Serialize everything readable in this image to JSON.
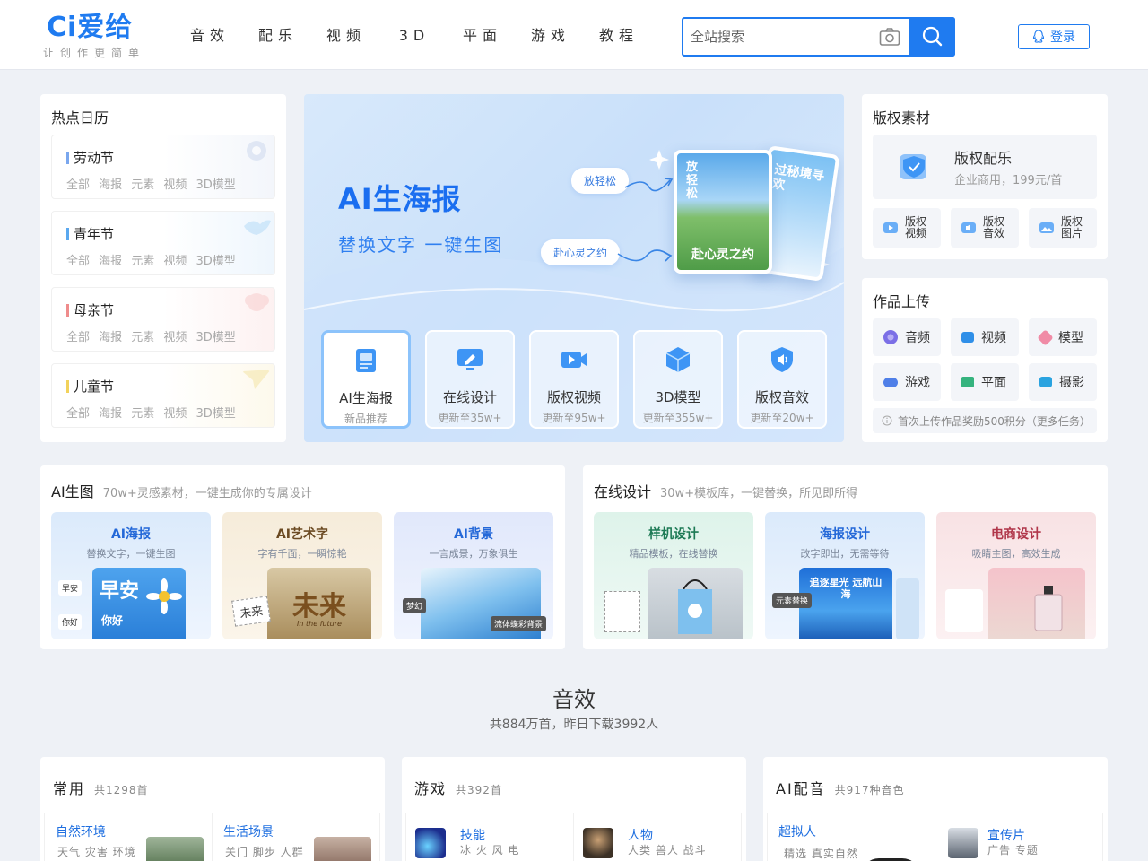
{
  "header": {
    "logo_mark": "Ci爱给",
    "logo_sub": "让创作更简单",
    "nav": [
      "音效",
      "配乐",
      "视频",
      "3D",
      "平面",
      "游戏",
      "教程"
    ],
    "search_placeholder": "全站搜索",
    "login": "登录"
  },
  "calendar": {
    "title": "热点日历",
    "items": [
      {
        "name": "劳动节",
        "tags": "全部 海报 元素 视频 3D模型",
        "color": "#7aa7ee"
      },
      {
        "name": "青年节",
        "tags": "全部 海报 元素 视频 3D模型",
        "color": "#5aa8ef"
      },
      {
        "name": "母亲节",
        "tags": "全部 海报 元素 视频 3D模型",
        "color": "#ef8c8c"
      },
      {
        "name": "儿童节",
        "tags": "全部 海报 元素 视频 3D模型",
        "color": "#f2d25b"
      }
    ]
  },
  "banner": {
    "title": "AI生海报",
    "subtitle": "替换文字 一键生图",
    "pill_1": "放轻松",
    "pill_2": "赴心灵之约",
    "poster_text_1": "放轻松",
    "poster_text_2": "赴心灵之约",
    "poster_text_3": "过秘境寻欢",
    "features": [
      {
        "title": "AI生海报",
        "sub": "新品推荐",
        "color": "#3e95f5"
      },
      {
        "title": "在线设计",
        "sub": "更新至35w+",
        "color": "#3e95f5"
      },
      {
        "title": "版权视频",
        "sub": "更新至95w+",
        "color": "#3e95f5"
      },
      {
        "title": "3D模型",
        "sub": "更新至355w+",
        "color": "#3e95f5"
      },
      {
        "title": "版权音效",
        "sub": "更新至20w+",
        "color": "#3e95f5"
      }
    ]
  },
  "copyright": {
    "title": "版权素材",
    "big_title": "版权配乐",
    "big_sub": "企业商用，199元/首",
    "small": [
      "版权\n视频",
      "版权\n音效",
      "版权\n图片"
    ]
  },
  "upload": {
    "title": "作品上传",
    "buttons": [
      {
        "label": "音频",
        "color": "#7b6fe6"
      },
      {
        "label": "视频",
        "color": "#2f8fe8"
      },
      {
        "label": "模型",
        "color": "#f08ba6"
      },
      {
        "label": "游戏",
        "color": "#4f7fe8"
      },
      {
        "label": "平面",
        "color": "#35b37e"
      },
      {
        "label": "摄影",
        "color": "#2aa3e0"
      }
    ],
    "notice": "首次上传作品奖励500积分（更多任务）"
  },
  "ai_section": {
    "title": "AI生图",
    "desc": "70w+灵感素材，一键生成你的专属设计",
    "tiles": [
      {
        "title": "AI海报",
        "sub": "替换文字，一键生图",
        "color": "#2468d8",
        "bg": "#dbeafb"
      },
      {
        "title": "AI艺术字",
        "sub": "字有千面，一瞬惊艳",
        "color": "#6b4a22",
        "bg": "#f6ecda"
      },
      {
        "title": "AI背景",
        "sub": "一言成景，万象俱生",
        "color": "#2468d8",
        "bg": "#e1e8fb"
      }
    ],
    "tile_tags": {
      "t1_a": "早安",
      "t1_b": "你好",
      "t1_img": "早安",
      "t1_img2": "你好",
      "t2_a": "未来",
      "t2_img": "未来",
      "t2_img_sub": "In the future",
      "t3_a": "梦幻",
      "t3_b": "流体蝶彩背景"
    }
  },
  "online_section": {
    "title": "在线设计",
    "desc": "30w+模板库，一键替换，所见即所得",
    "tiles": [
      {
        "title": "样机设计",
        "sub": "精品模板，在线替换",
        "color": "#1d7a55",
        "bg": "#def3ea"
      },
      {
        "title": "海报设计",
        "sub": "改字即出，无需等待",
        "color": "#2468d8",
        "bg": "#dbeafb"
      },
      {
        "title": "电商设计",
        "sub": "吸睛主图，高效生成",
        "color": "#b0364a",
        "bg": "#f8e2e4"
      }
    ],
    "tile_tags": {
      "t2_a": "元素替换",
      "t2_img": "追逐星光 远航山海"
    }
  },
  "sound": {
    "title": "音效",
    "sub": "共884万首，昨日下载3992人"
  },
  "bottom": [
    {
      "title": "常用",
      "count": "共1298首",
      "items": [
        {
          "name": "自然环境",
          "desc": "天气 灾害 环境"
        },
        {
          "name": "生活场景",
          "desc": "关门 脚步 人群"
        }
      ]
    },
    {
      "title": "游戏",
      "count": "共392首",
      "items": [
        {
          "name": "技能",
          "desc": "冰 火 风 电"
        },
        {
          "name": "人物",
          "desc": "人类 兽人 战斗"
        }
      ]
    },
    {
      "title": "AI配音",
      "count": "共917种音色",
      "items": [
        {
          "name": "超拟人",
          "desc": "精选 真实自然"
        },
        {
          "name": "宣传片",
          "desc": "广告 专题"
        }
      ]
    }
  ]
}
